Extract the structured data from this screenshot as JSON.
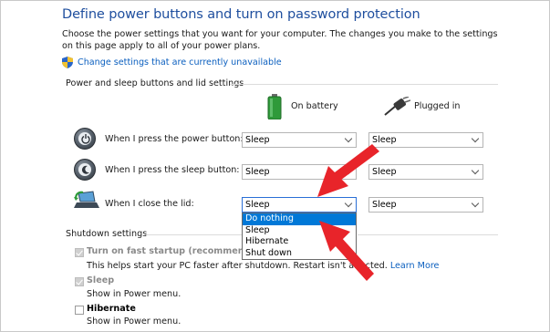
{
  "page": {
    "title": "Define power buttons and turn on password protection",
    "description": "Choose the power settings that you want for your computer. The changes you make to the settings on this page apply to all of your power plans.",
    "change_link": "Change settings that are currently unavailable"
  },
  "power_section": {
    "label": "Power and sleep buttons and lid settings",
    "columns": {
      "on_battery": "On battery",
      "plugged_in": "Plugged in"
    },
    "rows": [
      {
        "label": "When I press the power button:",
        "on_battery": "Sleep",
        "plugged_in": "Sleep"
      },
      {
        "label": "When I press the sleep button:",
        "on_battery": "Sleep",
        "plugged_in": "Sleep"
      },
      {
        "label": "When I close the lid:",
        "on_battery": "Sleep",
        "plugged_in": "Sleep"
      }
    ],
    "lid_dropdown_options": [
      "Do nothing",
      "Sleep",
      "Hibernate",
      "Shut down"
    ],
    "lid_dropdown_highlighted": "Do nothing"
  },
  "shutdown_section": {
    "label": "Shutdown settings",
    "options": [
      {
        "title": "Turn on fast startup (recommended)",
        "desc": "This helps start your PC faster after shutdown. Restart isn't affected.",
        "link": "Learn More",
        "checked": true,
        "disabled": true
      },
      {
        "title": "Sleep",
        "desc": "Show in Power menu.",
        "checked": true,
        "disabled": true
      },
      {
        "title": "Hibernate",
        "desc": "Show in Power menu.",
        "checked": false,
        "disabled": false
      }
    ]
  },
  "annotations": {
    "arrow_color": "#e8242a"
  }
}
